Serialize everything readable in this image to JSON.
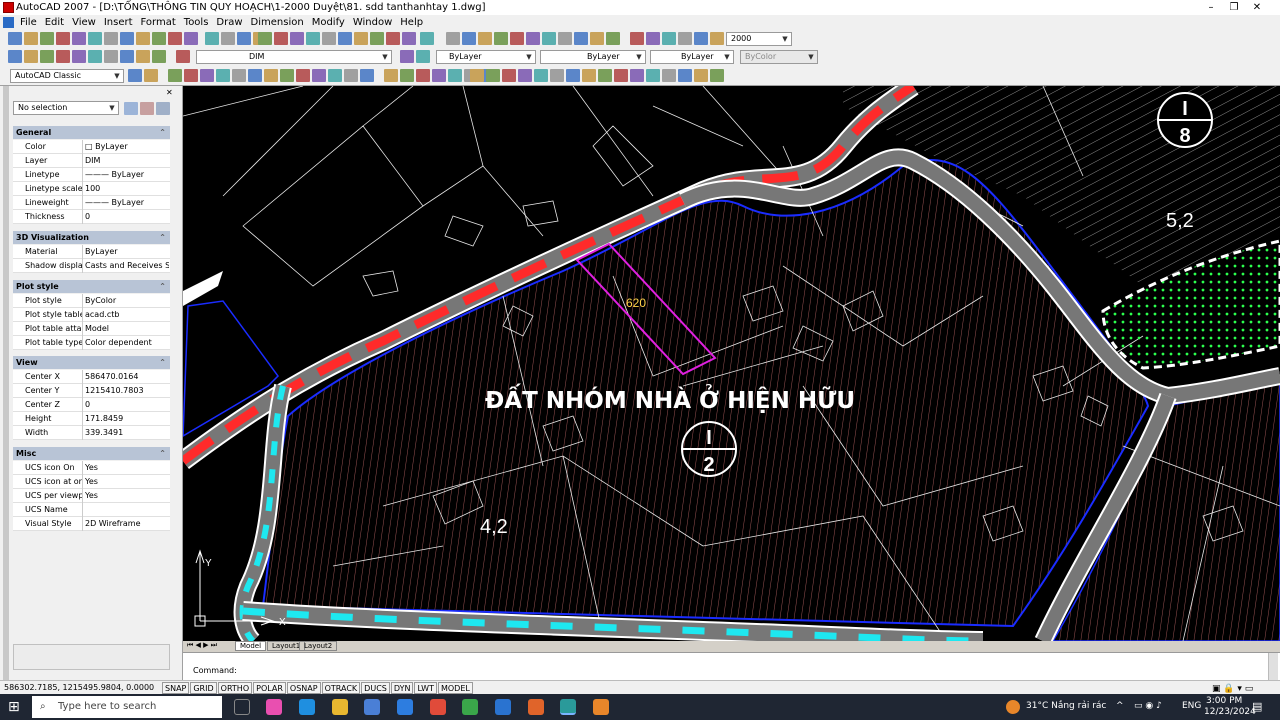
{
  "window": {
    "title": "AutoCAD 2007 - [D:\\TỔNG\\THÔNG TIN QUY HOẠCH\\1-2000 Duyệt\\81. sdd tanthanhtay 1.dwg]",
    "min": "–",
    "restore": "❐",
    "close": "✕"
  },
  "menu": [
    "File",
    "Edit",
    "View",
    "Insert",
    "Format",
    "Tools",
    "Draw",
    "Dimension",
    "Modify",
    "Window",
    "Help"
  ],
  "toolbar": {
    "scale_value": "2000",
    "layer_value": "DIM",
    "color_value": "ByLayer",
    "linetype_value": "ByLayer",
    "lineweight_value": "ByLayer",
    "plotstyle_value": "ByColor",
    "workspace_value": "AutoCAD Classic"
  },
  "palette": {
    "selection": "No selection",
    "sections": [
      {
        "title": "General",
        "rows": [
          {
            "k": "Color",
            "v": "□ ByLayer"
          },
          {
            "k": "Layer",
            "v": "DIM"
          },
          {
            "k": "Linetype",
            "v": "——— ByLayer"
          },
          {
            "k": "Linetype scale",
            "v": "100"
          },
          {
            "k": "Lineweight",
            "v": "——— ByLayer"
          },
          {
            "k": "Thickness",
            "v": "0"
          }
        ]
      },
      {
        "title": "3D Visualization",
        "rows": [
          {
            "k": "Material",
            "v": "ByLayer"
          },
          {
            "k": "Shadow display",
            "v": "Casts and Receives Sh..."
          }
        ]
      },
      {
        "title": "Plot style",
        "rows": [
          {
            "k": "Plot style",
            "v": "ByColor"
          },
          {
            "k": "Plot style table",
            "v": "acad.ctb"
          },
          {
            "k": "Plot table atta...",
            "v": "Model"
          },
          {
            "k": "Plot table type",
            "v": "Color dependent"
          }
        ]
      },
      {
        "title": "View",
        "rows": [
          {
            "k": "Center X",
            "v": "586470.0164"
          },
          {
            "k": "Center Y",
            "v": "1215410.7803"
          },
          {
            "k": "Center Z",
            "v": "0"
          },
          {
            "k": "Height",
            "v": "171.8459"
          },
          {
            "k": "Width",
            "v": "339.3491"
          }
        ]
      },
      {
        "title": "Misc",
        "rows": [
          {
            "k": "UCS icon On",
            "v": "Yes"
          },
          {
            "k": "UCS icon at or...",
            "v": "Yes"
          },
          {
            "k": "UCS per viewp...",
            "v": "Yes"
          },
          {
            "k": "UCS Name",
            "v": ""
          },
          {
            "k": "Visual Style",
            "v": "2D Wireframe"
          }
        ]
      }
    ]
  },
  "drawing": {
    "zone_label": "ĐẤT NHÓM NHÀ Ở HIỆN HỮU",
    "zone_id_top": "I",
    "zone_id_bottom": "2",
    "zone_ne_top": "I",
    "zone_ne_bottom": "8",
    "label_left": "4,2",
    "label_right": "5,2",
    "dim_value": "620",
    "ucs_x": "X",
    "ucs_y": "Y"
  },
  "tabs": [
    "Model",
    "Layout1",
    "Layout2"
  ],
  "command_prompt": "Command:",
  "status": {
    "coords": "586302.7185, 1215495.9804, 0.0000",
    "toggles": [
      "SNAP",
      "GRID",
      "ORTHO",
      "POLAR",
      "OSNAP",
      "OTRACK",
      "DUCS",
      "DYN",
      "LWT",
      "MODEL"
    ]
  },
  "taskbar": {
    "search_placeholder": "Type here to search",
    "weather": "31°C  Nắng rải rác",
    "lang": "ENG",
    "time": "3:00 PM",
    "date": "12/23/2024"
  }
}
